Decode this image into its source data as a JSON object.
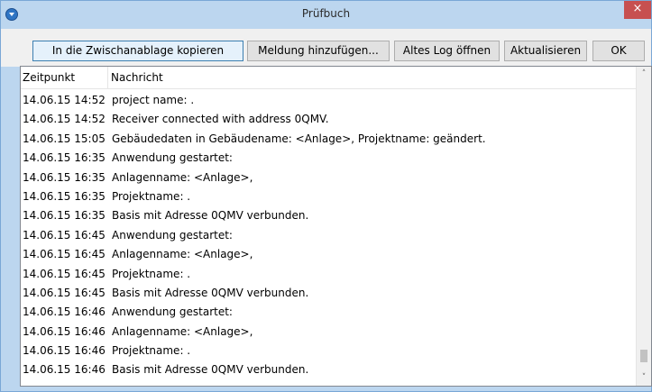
{
  "window": {
    "title": "Prüfbuch",
    "close_glyph": "×"
  },
  "toolbar": {
    "copy_label": "In die Zwischanablage kopieren",
    "add_message_label": "Meldung hinzufügen...",
    "open_old_log_label": "Altes Log öffnen",
    "refresh_label": "Aktualisieren",
    "ok_label": "OK"
  },
  "list": {
    "columns": [
      "Zeitpunkt",
      "Nachricht"
    ],
    "rows": [
      {
        "time": "14.06.15 14:52",
        "message": "project name: ."
      },
      {
        "time": "14.06.15 14:52",
        "message": "Receiver connected with address 0QMV."
      },
      {
        "time": "14.06.15 15:05",
        "message": "Gebäudedaten in Gebäudename: <Anlage>, Projektname:  geändert."
      },
      {
        "time": "14.06.15 16:35",
        "message": "Anwendung gestartet:"
      },
      {
        "time": "14.06.15 16:35",
        "message": "Anlagenname: <Anlage>,"
      },
      {
        "time": "14.06.15 16:35",
        "message": "Projektname: ."
      },
      {
        "time": "14.06.15 16:35",
        "message": "Basis mit Adresse 0QMV verbunden."
      },
      {
        "time": "14.06.15 16:45",
        "message": "Anwendung gestartet:"
      },
      {
        "time": "14.06.15 16:45",
        "message": "Anlagenname: <Anlage>,"
      },
      {
        "time": "14.06.15 16:45",
        "message": "Projektname: ."
      },
      {
        "time": "14.06.15 16:45",
        "message": "Basis mit Adresse 0QMV verbunden."
      },
      {
        "time": "14.06.15 16:46",
        "message": "Anwendung gestartet:"
      },
      {
        "time": "14.06.15 16:46",
        "message": "Anlagenname: <Anlage>,"
      },
      {
        "time": "14.06.15 16:46",
        "message": "Projektname: ."
      },
      {
        "time": "14.06.15 16:46",
        "message": "Basis mit Adresse 0QMV verbunden."
      }
    ]
  },
  "scrollbar": {
    "up_glyph": "˄",
    "down_glyph": "˅",
    "position": 0.97
  },
  "colors": {
    "titlebar": "#bcd6ef",
    "close_button": "#c75050",
    "toolbar_bg": "#f0f0f0",
    "default_button_border": "#3c7fb1"
  }
}
